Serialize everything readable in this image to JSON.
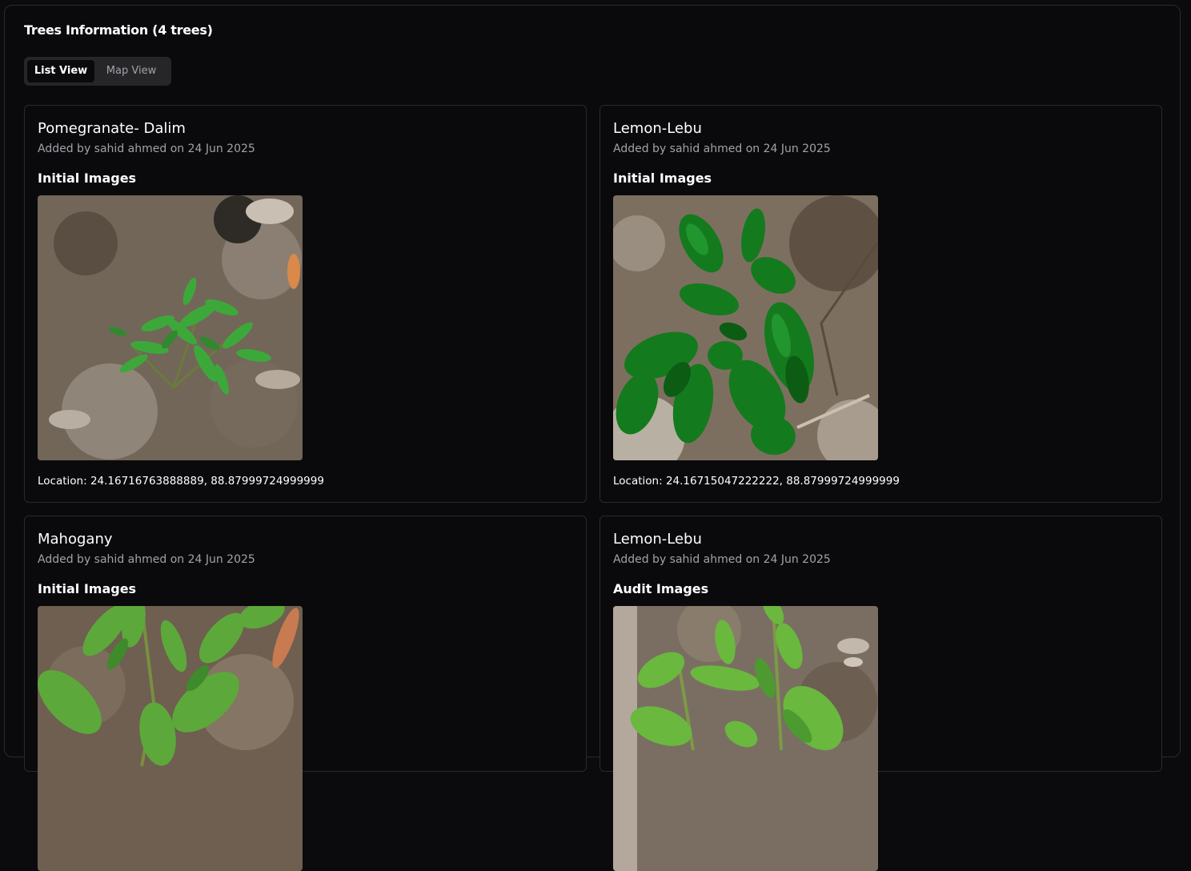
{
  "page": {
    "title": "Trees Information (4 trees)"
  },
  "view_toggle": {
    "list_label": "List View",
    "map_label": "Map View",
    "selected": "List View"
  },
  "trees": [
    {
      "name": "Pomegranate- Dalim",
      "added_by": "Added by sahid ahmed on 24 Jun 2025",
      "section": "Initial Images",
      "location": "Location: 24.16716763888889, 88.87999724999999"
    },
    {
      "name": "Lemon-Lebu",
      "added_by": "Added by sahid ahmed on 24 Jun 2025",
      "section": "Initial Images",
      "location": "Location: 24.16715047222222, 88.87999724999999"
    },
    {
      "name": "Mahogany",
      "added_by": "Added by sahid ahmed on 24 Jun 2025",
      "section": "Initial Images",
      "location": ""
    },
    {
      "name": "Lemon-Lebu",
      "added_by": "Added by sahid ahmed on 24 Jun 2025",
      "section": "Audit Images",
      "location": ""
    }
  ],
  "colors": {
    "background": "#0a0a0c",
    "border": "#2a2a2e",
    "muted_text": "#a1a1aa",
    "toggle_bg": "#262629"
  }
}
